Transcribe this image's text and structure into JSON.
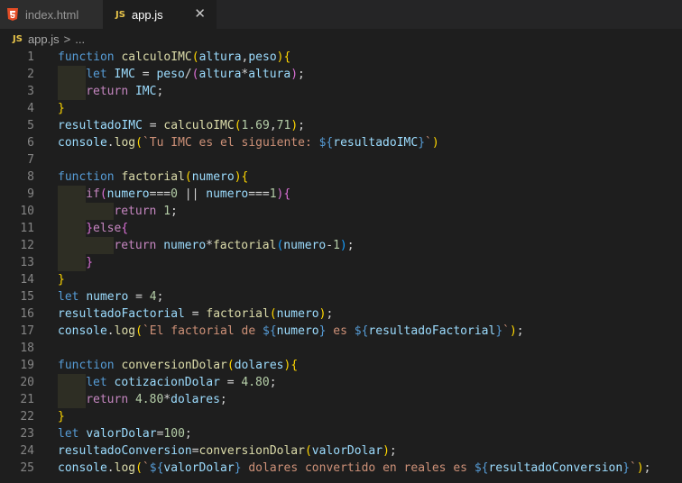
{
  "tabs": [
    {
      "label": "index.html",
      "icon": "html5-icon",
      "active": false
    },
    {
      "label": "app.js",
      "icon": "js-icon",
      "active": true,
      "close": "✕"
    }
  ],
  "breadcrumb": {
    "icon_text": "JS",
    "file": "app.js",
    "separator": ">",
    "more": "..."
  },
  "colors": {
    "keyword": "#569cd6",
    "control": "#c586c0",
    "function": "#dcdcaa",
    "variable": "#9cdcfe",
    "number": "#b5cea8",
    "string": "#ce9178",
    "bracket_gold": "#ffd700",
    "bracket_purple": "#da70d6",
    "bracket_blue": "#179fff"
  },
  "lines": [
    {
      "n": "1",
      "indent": 0,
      "tokens": [
        [
          "k",
          "function "
        ],
        [
          "f",
          "calculoIMC"
        ],
        [
          "b1",
          "("
        ],
        [
          "v",
          "altura"
        ],
        [
          "p",
          ","
        ],
        [
          "v",
          "peso"
        ],
        [
          "b1",
          ")"
        ],
        [
          "b1",
          "{"
        ]
      ]
    },
    {
      "n": "2",
      "indent": 1,
      "tokens": [
        [
          "k",
          "let "
        ],
        [
          "v",
          "IMC"
        ],
        [
          "p",
          " = "
        ],
        [
          "v",
          "peso"
        ],
        [
          "p",
          "/"
        ],
        [
          "b2",
          "("
        ],
        [
          "v",
          "altura"
        ],
        [
          "p",
          "*"
        ],
        [
          "v",
          "altura"
        ],
        [
          "b2",
          ")"
        ],
        [
          "p",
          ";"
        ]
      ]
    },
    {
      "n": "3",
      "indent": 1,
      "tokens": [
        [
          "c",
          "return "
        ],
        [
          "v",
          "IMC"
        ],
        [
          "p",
          ";"
        ]
      ]
    },
    {
      "n": "4",
      "indent": 0,
      "tokens": [
        [
          "b1",
          "}"
        ]
      ]
    },
    {
      "n": "5",
      "indent": 0,
      "tokens": [
        [
          "v",
          "resultadoIMC"
        ],
        [
          "p",
          " = "
        ],
        [
          "f",
          "calculoIMC"
        ],
        [
          "b1",
          "("
        ],
        [
          "n",
          "1.69"
        ],
        [
          "p",
          ","
        ],
        [
          "n",
          "71"
        ],
        [
          "b1",
          ")"
        ],
        [
          "p",
          ";"
        ]
      ]
    },
    {
      "n": "6",
      "indent": 0,
      "tokens": [
        [
          "v",
          "console"
        ],
        [
          "p",
          "."
        ],
        [
          "f",
          "log"
        ],
        [
          "b1",
          "("
        ],
        [
          "s",
          "`Tu IMC es el siguiente: "
        ],
        [
          "b4",
          "${"
        ],
        [
          "v",
          "resultadoIMC"
        ],
        [
          "b4",
          "}"
        ],
        [
          "s",
          "`"
        ],
        [
          "b1",
          ")"
        ]
      ]
    },
    {
      "n": "7",
      "indent": 0,
      "tokens": []
    },
    {
      "n": "8",
      "indent": 0,
      "tokens": [
        [
          "k",
          "function "
        ],
        [
          "f",
          "factorial"
        ],
        [
          "b1",
          "("
        ],
        [
          "v",
          "numero"
        ],
        [
          "b1",
          ")"
        ],
        [
          "b1",
          "{"
        ]
      ]
    },
    {
      "n": "9",
      "indent": 1,
      "tokens": [
        [
          "c",
          "if"
        ],
        [
          "b2",
          "("
        ],
        [
          "v",
          "numero"
        ],
        [
          "p",
          "==="
        ],
        [
          "n",
          "0"
        ],
        [
          "p",
          " || "
        ],
        [
          "v",
          "numero"
        ],
        [
          "p",
          "==="
        ],
        [
          "n",
          "1"
        ],
        [
          "b2",
          ")"
        ],
        [
          "b2",
          "{"
        ]
      ]
    },
    {
      "n": "10",
      "indent": 2,
      "tokens": [
        [
          "c",
          "return "
        ],
        [
          "n",
          "1"
        ],
        [
          "p",
          ";"
        ]
      ]
    },
    {
      "n": "11",
      "indent": 1,
      "tokens": [
        [
          "b2",
          "}"
        ],
        [
          "c",
          "else"
        ],
        [
          "b2",
          "{"
        ]
      ]
    },
    {
      "n": "12",
      "indent": 2,
      "tokens": [
        [
          "c",
          "return "
        ],
        [
          "v",
          "numero"
        ],
        [
          "p",
          "*"
        ],
        [
          "f",
          "factorial"
        ],
        [
          "b3",
          "("
        ],
        [
          "v",
          "numero"
        ],
        [
          "p",
          "-"
        ],
        [
          "n",
          "1"
        ],
        [
          "b3",
          ")"
        ],
        [
          "p",
          ";"
        ]
      ]
    },
    {
      "n": "13",
      "indent": 1,
      "tokens": [
        [
          "b2",
          "}"
        ]
      ]
    },
    {
      "n": "14",
      "indent": 0,
      "tokens": [
        [
          "b1",
          "}"
        ]
      ]
    },
    {
      "n": "15",
      "indent": 0,
      "tokens": [
        [
          "k",
          "let "
        ],
        [
          "v",
          "numero"
        ],
        [
          "p",
          " = "
        ],
        [
          "n",
          "4"
        ],
        [
          "p",
          ";"
        ]
      ]
    },
    {
      "n": "16",
      "indent": 0,
      "tokens": [
        [
          "v",
          "resultadoFactorial"
        ],
        [
          "p",
          " = "
        ],
        [
          "f",
          "factorial"
        ],
        [
          "b1",
          "("
        ],
        [
          "v",
          "numero"
        ],
        [
          "b1",
          ")"
        ],
        [
          "p",
          ";"
        ]
      ]
    },
    {
      "n": "17",
      "indent": 0,
      "tokens": [
        [
          "v",
          "console"
        ],
        [
          "p",
          "."
        ],
        [
          "f",
          "log"
        ],
        [
          "b1",
          "("
        ],
        [
          "s",
          "`El factorial de "
        ],
        [
          "b4",
          "${"
        ],
        [
          "v",
          "numero"
        ],
        [
          "b4",
          "}"
        ],
        [
          "s",
          " es "
        ],
        [
          "b4",
          "${"
        ],
        [
          "v",
          "resultadoFactorial"
        ],
        [
          "b4",
          "}"
        ],
        [
          "s",
          "`"
        ],
        [
          "b1",
          ")"
        ],
        [
          "p",
          ";"
        ]
      ]
    },
    {
      "n": "18",
      "indent": 0,
      "tokens": []
    },
    {
      "n": "19",
      "indent": 0,
      "tokens": [
        [
          "k",
          "function "
        ],
        [
          "f",
          "conversionDolar"
        ],
        [
          "b1",
          "("
        ],
        [
          "v",
          "dolares"
        ],
        [
          "b1",
          ")"
        ],
        [
          "b1",
          "{"
        ]
      ]
    },
    {
      "n": "20",
      "indent": 1,
      "tokens": [
        [
          "k",
          "let "
        ],
        [
          "v",
          "cotizacionDolar"
        ],
        [
          "p",
          " = "
        ],
        [
          "n",
          "4.80"
        ],
        [
          "p",
          ";"
        ]
      ]
    },
    {
      "n": "21",
      "indent": 1,
      "tokens": [
        [
          "c",
          "return "
        ],
        [
          "n",
          "4.80"
        ],
        [
          "p",
          "*"
        ],
        [
          "v",
          "dolares"
        ],
        [
          "p",
          ";"
        ]
      ]
    },
    {
      "n": "22",
      "indent": 0,
      "tokens": [
        [
          "b1",
          "}"
        ]
      ]
    },
    {
      "n": "23",
      "indent": 0,
      "tokens": [
        [
          "k",
          "let "
        ],
        [
          "v",
          "valorDolar"
        ],
        [
          "p",
          "="
        ],
        [
          "n",
          "100"
        ],
        [
          "p",
          ";"
        ]
      ]
    },
    {
      "n": "24",
      "indent": 0,
      "tokens": [
        [
          "v",
          "resultadoConversion"
        ],
        [
          "p",
          "="
        ],
        [
          "f",
          "conversionDolar"
        ],
        [
          "b1",
          "("
        ],
        [
          "v",
          "valorDolar"
        ],
        [
          "b1",
          ")"
        ],
        [
          "p",
          ";"
        ]
      ]
    },
    {
      "n": "25",
      "indent": 0,
      "tokens": [
        [
          "v",
          "console"
        ],
        [
          "p",
          "."
        ],
        [
          "f",
          "log"
        ],
        [
          "b1",
          "("
        ],
        [
          "s",
          "`"
        ],
        [
          "b4",
          "${"
        ],
        [
          "v",
          "valorDolar"
        ],
        [
          "b4",
          "}"
        ],
        [
          "s",
          " dolares convertido en reales es "
        ],
        [
          "b4",
          "${"
        ],
        [
          "v",
          "resultadoConversion"
        ],
        [
          "b4",
          "}"
        ],
        [
          "s",
          "`"
        ],
        [
          "b1",
          ")"
        ],
        [
          "p",
          ";"
        ]
      ]
    }
  ]
}
